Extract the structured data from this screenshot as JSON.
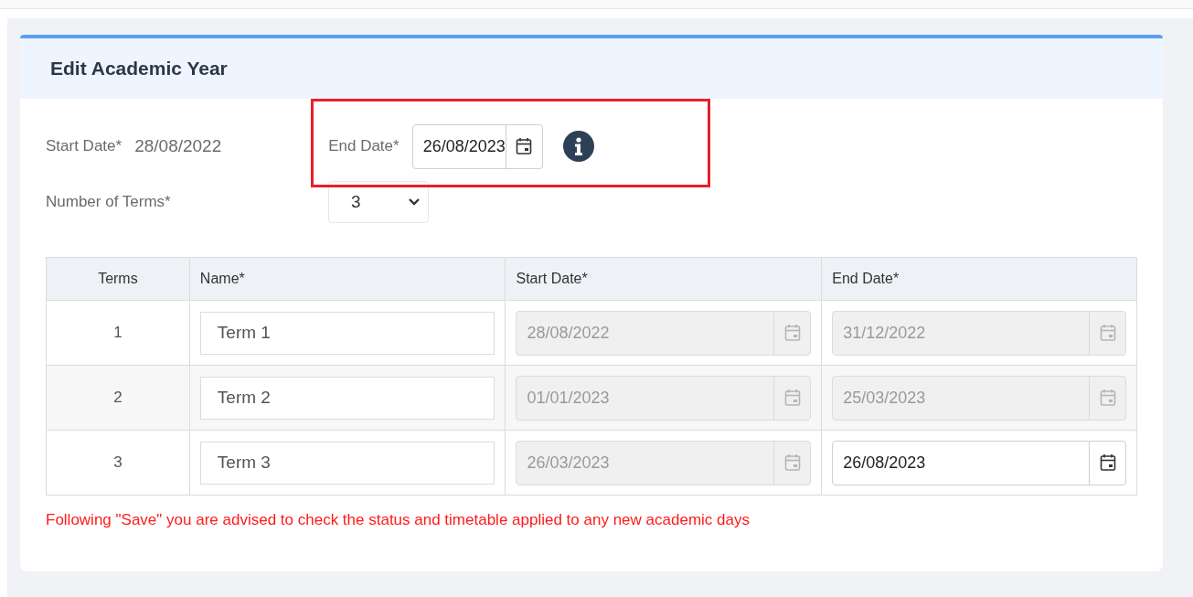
{
  "form": {
    "title": "Edit Academic Year",
    "start_date": {
      "label": "Start Date*",
      "value": "28/08/2022"
    },
    "end_date": {
      "label": "End Date*",
      "value": "26/08/2023",
      "disabled": false,
      "highlighted": true
    },
    "number_of_terms": {
      "label": "Number of Terms*",
      "value": "3"
    },
    "table": {
      "columns": [
        "Terms",
        "Name*",
        "Start Date*",
        "End Date*"
      ],
      "rows": [
        {
          "term": "1",
          "name": "Term 1",
          "start_date": {
            "value": "28/08/2022",
            "disabled": true
          },
          "end_date": {
            "value": "31/12/2022",
            "disabled": true
          }
        },
        {
          "term": "2",
          "name": "Term 2",
          "start_date": {
            "value": "01/01/2023",
            "disabled": true
          },
          "end_date": {
            "value": "25/03/2023",
            "disabled": true
          }
        },
        {
          "term": "3",
          "name": "Term 3",
          "start_date": {
            "value": "26/03/2023",
            "disabled": true
          },
          "end_date": {
            "value": "26/08/2023",
            "disabled": false
          }
        }
      ]
    },
    "warning": "Following \"Save\" you are advised to check the status and timetable applied to any new academic days"
  }
}
